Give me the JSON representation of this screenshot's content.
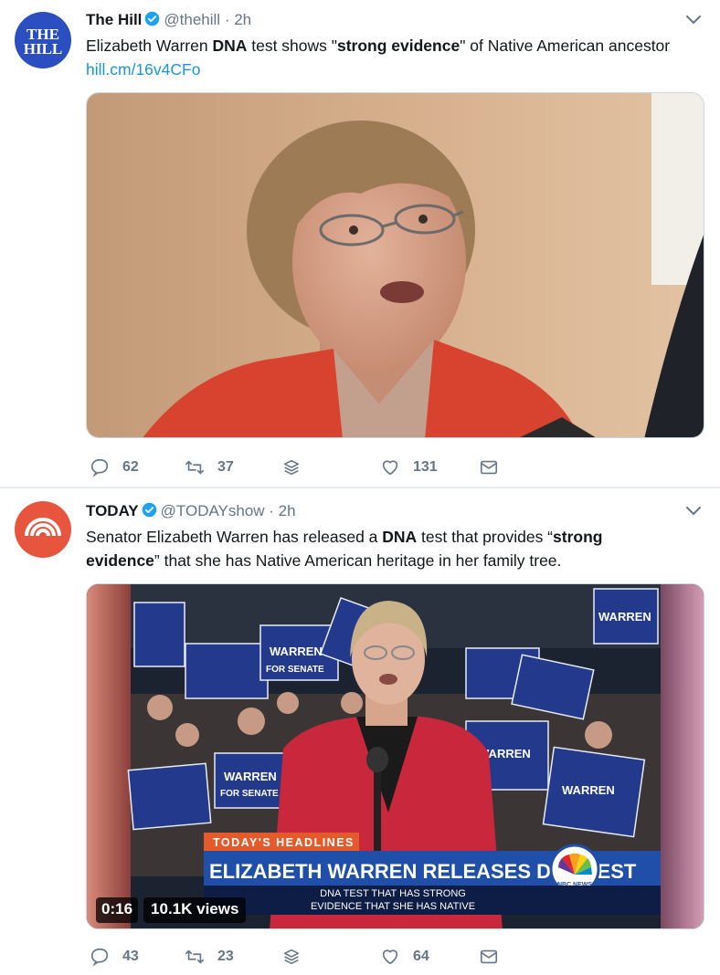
{
  "tweets": [
    {
      "account_name": "The Hill",
      "handle": "@thehill",
      "time": " · 2h",
      "avatar_text_line1": "THE",
      "avatar_text_line2": "HILL",
      "text": {
        "part1": "Elizabeth Warren ",
        "bold1": "DNA",
        "part2": " test shows \"",
        "bold2": "strong evidence",
        "part3": "\" of Native American ancestor ",
        "link": "hill.cm/16v4CFo"
      },
      "media_icon": "photo-of-speaking-woman",
      "counts": {
        "replies": "62",
        "retweets": "37",
        "likes": "131"
      }
    },
    {
      "account_name": "TODAY",
      "handle": "@TODAYshow",
      "time": " · 2h",
      "text": {
        "part1": "Senator Elizabeth Warren has released a ",
        "bold1": "DNA",
        "part2": " test that provides “",
        "bold2": "strong evidence",
        "part3": "” that she has Native American heritage in her family tree."
      },
      "video": {
        "headline_tag": "TODAY'S HEADLINES",
        "headline": "ELIZABETH WARREN RELEASES DNA TEST",
        "caption_line1": "DNA TEST THAT HAS STRONG",
        "caption_line2": "EVIDENCE THAT SHE HAS NATIVE",
        "network_logo": "NBC NEWS",
        "duration": "0:16",
        "views": "10.1K views",
        "sign_text_1": "WARREN",
        "sign_text_2": "FOR SENATE"
      },
      "counts": {
        "replies": "43",
        "retweets": "23",
        "likes": "64"
      }
    }
  ],
  "colors": {
    "link": "#1b95e0",
    "verified": "#1da1f2",
    "hill_avatar": "#2b4ec0",
    "today_avatar": "#e8553e",
    "icon_gray": "#657786"
  }
}
